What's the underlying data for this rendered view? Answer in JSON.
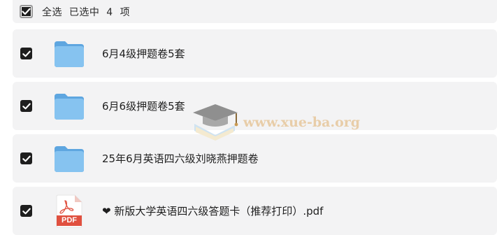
{
  "header": {
    "select_all_label": "全选  已选中  4  项"
  },
  "items": [
    {
      "name": "6月4级押题卷5套",
      "type": "folder",
      "checked": true
    },
    {
      "name": "6月6级押题卷5套",
      "type": "folder",
      "checked": true
    },
    {
      "name": "25年6月英语四六级刘晓燕押题卷",
      "type": "folder",
      "checked": true
    },
    {
      "name": "❤ 新版大学英语四六级答题卡（推荐打印）.pdf",
      "type": "pdf",
      "checked": true,
      "badge": "PDF"
    }
  ],
  "watermark": {
    "text": "www.xue-ba.org"
  },
  "colors": {
    "row_bg": "#f3f3f4",
    "checkbox": "#1e1e1e",
    "folder": "#7bbcec",
    "pdf_red": "#e0503f"
  }
}
